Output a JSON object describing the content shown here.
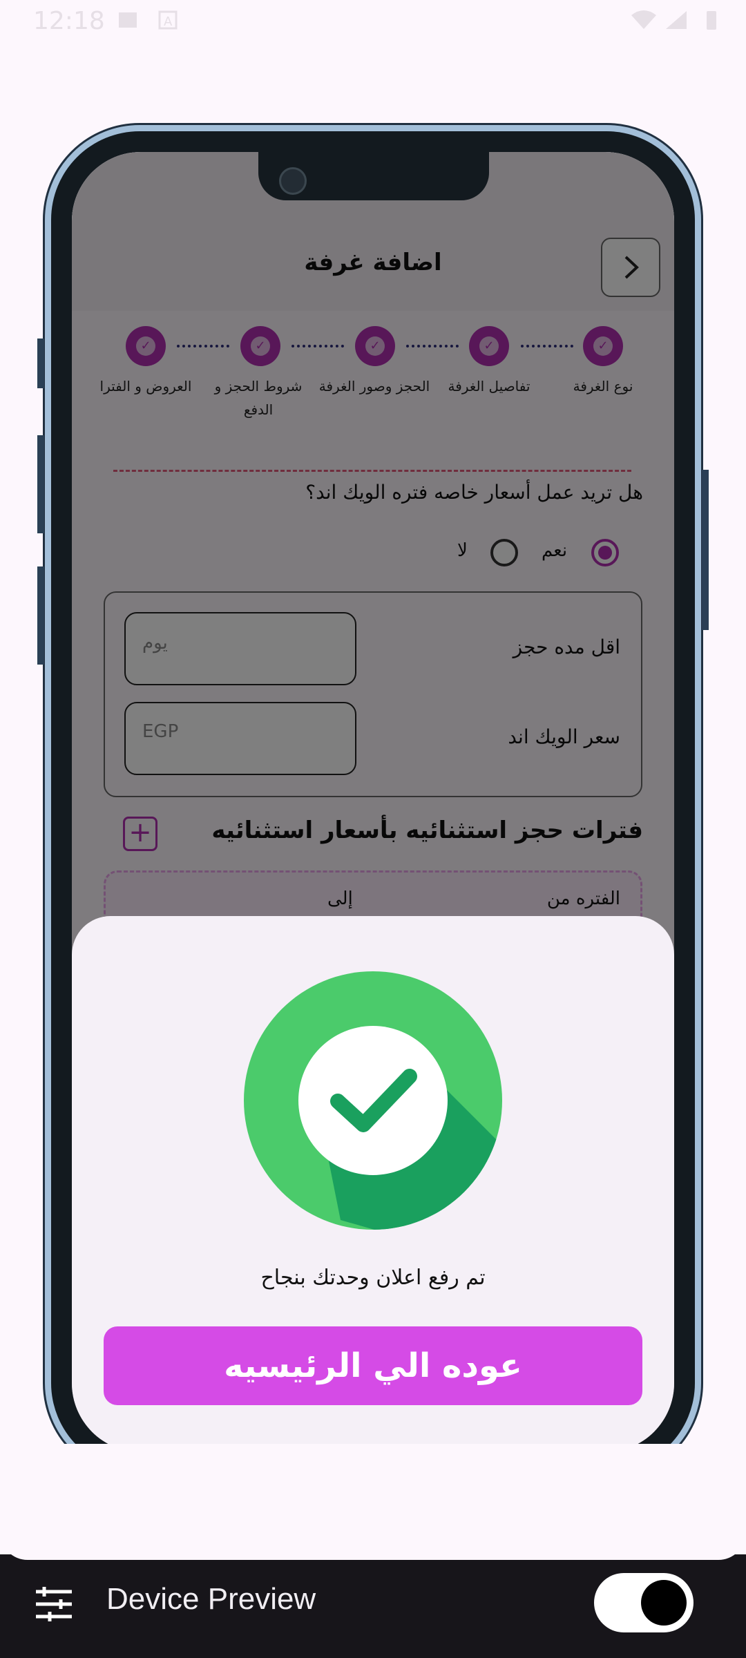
{
  "status_bar": {
    "time": "12:18"
  },
  "app": {
    "title": "اضافة غرفة",
    "steps": [
      "نوع الغرفة",
      "تفاصيل الغرفة",
      "الحجز وصور الغرفة",
      "شروط الحجز و الدفع",
      "العروض و الفترا"
    ],
    "weekend_question": "هل تريد عمل أسعار خاصه فتره الويك اند؟",
    "radio_yes": "نعم",
    "radio_no": "لا",
    "min_stay_label": "اقل مده حجز",
    "min_stay_placeholder": "يوم",
    "weekend_price_label": "سعر الويك اند",
    "weekend_price_placeholder": "EGP",
    "exceptional_periods_title": "فترات حجز استثنائيه بأسعار استثنائيه",
    "period_from": "الفتره من",
    "period_to": "إلى"
  },
  "success_sheet": {
    "message": "تم رفع اعلان وحدتك بنجاح",
    "home_button": "عوده الي الرئيسيه"
  },
  "device_preview": {
    "label": "Device Preview",
    "toggle_on": true
  },
  "colors": {
    "accent": "#d54be6",
    "step": "#b12fb1",
    "success": "#4bcb6b"
  }
}
